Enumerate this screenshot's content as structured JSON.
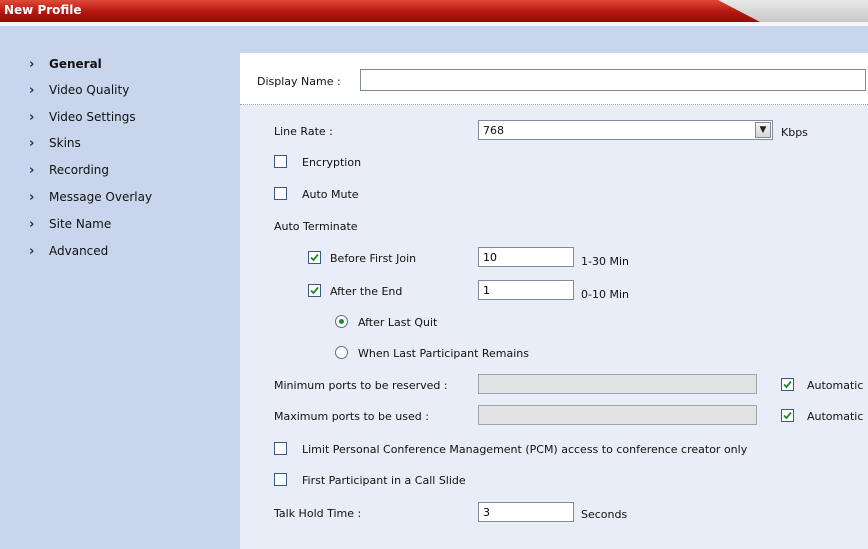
{
  "window": {
    "title": "New Profile"
  },
  "sidebar": {
    "items": [
      {
        "label": "General",
        "active": true
      },
      {
        "label": "Video Quality"
      },
      {
        "label": "Video Settings"
      },
      {
        "label": "Skins"
      },
      {
        "label": "Recording"
      },
      {
        "label": "Message Overlay"
      },
      {
        "label": "Site Name"
      },
      {
        "label": "Advanced"
      }
    ]
  },
  "form": {
    "display_name": {
      "label": "Display Name :",
      "value": ""
    },
    "line_rate": {
      "label": "Line Rate :",
      "value": "768",
      "unit": "Kbps"
    },
    "encryption": {
      "label": "Encryption",
      "checked": false
    },
    "auto_mute": {
      "label": "Auto Mute",
      "checked": false
    },
    "auto_terminate": {
      "label": "Auto Terminate",
      "before_first_join": {
        "label": "Before First Join",
        "checked": true,
        "value": "10",
        "range": "1-30 Min"
      },
      "after_the_end": {
        "label": "After the End",
        "checked": true,
        "value": "1",
        "range": "0-10 Min"
      },
      "after_last_quit": {
        "label": "After Last Quit",
        "selected": true
      },
      "when_last_participant_remains": {
        "label": "When Last Participant Remains",
        "selected": false
      }
    },
    "min_ports": {
      "label": "Minimum ports to be reserved :",
      "value": "",
      "auto_label": "Automatic",
      "auto_checked": true
    },
    "max_ports": {
      "label": "Maximum ports to be used :",
      "value": "",
      "auto_label": "Automatic",
      "auto_checked": true
    },
    "limit_pcm": {
      "label": "Limit Personal Conference Management (PCM) access to conference creator only",
      "checked": false
    },
    "first_participant_slide": {
      "label": "First Participant in a Call Slide",
      "checked": false
    },
    "talk_hold_time": {
      "label": "Talk Hold Time :",
      "value": "3",
      "unit": "Seconds"
    }
  },
  "colors": {
    "title_red": "#b4150d",
    "sidebar_bg": "#c9d5ec",
    "content_bg": "#e8edf7",
    "check_green": "#1d8b23"
  }
}
